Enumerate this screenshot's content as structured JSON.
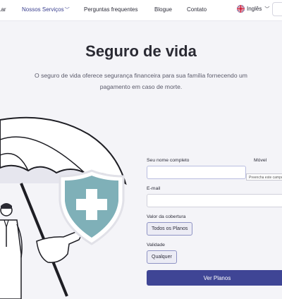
{
  "nav": {
    "items": [
      "Lar",
      "Nossos Serviços",
      "Perguntas frequentes",
      "Blogue",
      "Contato"
    ],
    "language": "Inglês"
  },
  "hero": {
    "title": "Seguro de vida",
    "subtitle": "O seguro de vida oferece segurança financeira para sua família fornecendo um pagamento em caso de morte."
  },
  "form": {
    "name_label": "Seu nome completo",
    "mobile_label": "Móvel",
    "required_tooltip": "Preencha este campo.",
    "email_label": "E-mail",
    "coverage_label": "Valor da cobertura",
    "coverage_value": "Todos os Planos",
    "validity_label": "Validade",
    "validity_value": "Qualquer",
    "submit_label": "Ver Planos"
  },
  "colors": {
    "accent": "#3f4595",
    "shield": "#7fb0b8",
    "background": "#f4f4f8"
  }
}
